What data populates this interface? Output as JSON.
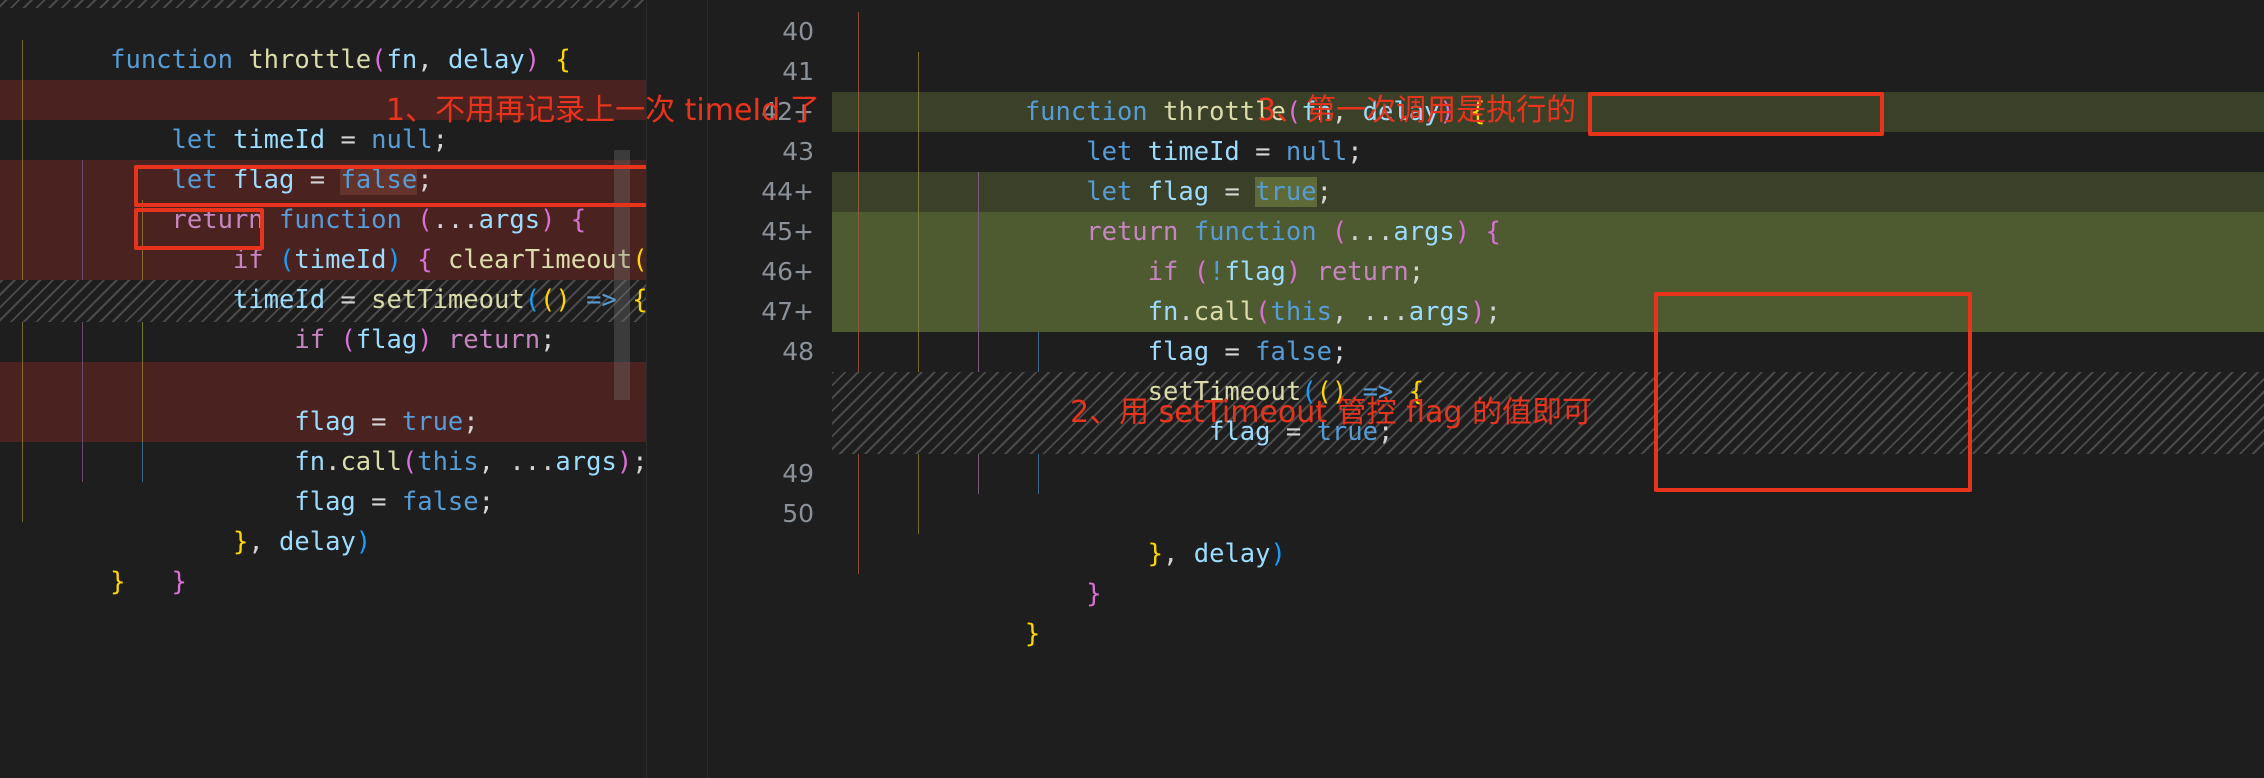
{
  "editor": {
    "theme_background": "#1e1e1e",
    "diff_removed_color": "#4a2220",
    "diff_added_color": "#4e5a30",
    "annotation_color": "#e8341c",
    "language": "javascript"
  },
  "left_pane": {
    "name": "original-version",
    "lines": [
      {
        "kind": "plain",
        "text": "function throttle(fn, delay) {"
      },
      {
        "kind": "plain",
        "text": "    let timeId = null;"
      },
      {
        "kind": "del",
        "text": "    let flag = false;"
      },
      {
        "kind": "plain",
        "text": "    return function (...args) {"
      },
      {
        "kind": "del",
        "text": "        if (timeId) { clearTimeout(time"
      },
      {
        "kind": "del",
        "text": "        timeId = setTimeout(() => {"
      },
      {
        "kind": "del",
        "text": "            if (flag) return;"
      },
      {
        "kind": "hatch",
        "text": ""
      },
      {
        "kind": "plain",
        "text": "            flag = true;"
      },
      {
        "kind": "del",
        "text": "            fn.call(this, ...args);"
      },
      {
        "kind": "del",
        "text": "            flag = false;"
      },
      {
        "kind": "plain",
        "text": "        }, delay)"
      },
      {
        "kind": "plain",
        "text": "    }"
      },
      {
        "kind": "plain",
        "text": "}"
      }
    ]
  },
  "right_pane": {
    "name": "modified-version",
    "line_numbers": [
      "40",
      "41",
      "42+",
      "43",
      "44+",
      "45+",
      "46+",
      "47+",
      "48",
      "",
      "49",
      "50"
    ],
    "lines": [
      {
        "number": "40",
        "kind": "plain",
        "text": "function throttle(fn, delay) {"
      },
      {
        "number": "41",
        "kind": "plain",
        "text": "    let timeId = null;"
      },
      {
        "number": "42+",
        "kind": "insdim",
        "text": "    let flag = true;"
      },
      {
        "number": "43",
        "kind": "plain",
        "text": "    return function (...args) {"
      },
      {
        "number": "44+",
        "kind": "insdim",
        "text": "        if (!flag) return;"
      },
      {
        "number": "45+",
        "kind": "ins",
        "text": "        fn.call(this, ...args);"
      },
      {
        "number": "46+",
        "kind": "ins",
        "text": "        flag = false;"
      },
      {
        "number": "47+",
        "kind": "ins",
        "text": "        setTimeout(() => {"
      },
      {
        "number": "48",
        "kind": "plain",
        "text": "            flag = true;"
      },
      {
        "number": "",
        "kind": "hatch",
        "text": ""
      },
      {
        "number": "49",
        "kind": "plain",
        "text": "        }, delay)"
      },
      {
        "number": "50",
        "kind": "plain",
        "text": "    }"
      }
    ]
  },
  "annotations": [
    {
      "id": "note-1",
      "text": "1、不用再记录上一次 timeId 了"
    },
    {
      "id": "note-3",
      "text": "3、第一次调用是执行的"
    },
    {
      "id": "note-2",
      "text": "2、用 setTimeout 管控 flag 的值即可"
    }
  ],
  "highlight_boxes": [
    {
      "id": "box-if-timeid",
      "target": "if (timeId) { clearTimeout(time"
    },
    {
      "id": "box-timeid",
      "target": "timeId"
    },
    {
      "id": "box-let-flag-true",
      "target": "let flag = true;"
    },
    {
      "id": "box-settimeout",
      "target": "setTimeout(() => { ... }, delay)"
    }
  ]
}
